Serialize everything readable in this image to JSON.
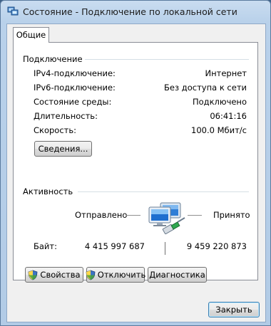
{
  "window": {
    "title": "Состояние - Подключение по локальной сети"
  },
  "tabs": [
    {
      "label": "Общие"
    }
  ],
  "connection": {
    "group_title": "Подключение",
    "rows": [
      {
        "label": "IPv4-подключение:",
        "value": "Интернет"
      },
      {
        "label": "IPv6-подключение:",
        "value": "Без доступа к сети"
      },
      {
        "label": "Состояние среды:",
        "value": "Подключено"
      },
      {
        "label": "Длительность:",
        "value": "06:41:16"
      },
      {
        "label": "Скорость:",
        "value": "100.0 Мбит/с"
      }
    ],
    "details_button": "Сведения..."
  },
  "activity": {
    "group_title": "Активность",
    "sent_label": "Отправлено",
    "received_label": "Принято",
    "bytes_label": "Байт:",
    "bytes_sent": "4 415 997 687",
    "bytes_received": "9 459 220 873",
    "icon": "network-computers-icon"
  },
  "buttons": {
    "properties": "Свойства",
    "disable": "Отключить",
    "diagnose": "Диагностика",
    "close": "Закрыть"
  },
  "colors": {
    "title_bar": "#b9d1ea",
    "panel": "#ffffff",
    "dialog": "#f0f0f0",
    "group_line": "#d5dfe5"
  }
}
